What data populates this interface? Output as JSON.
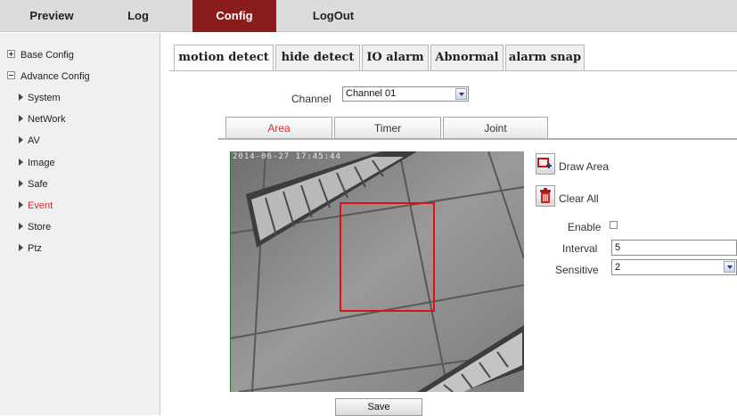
{
  "nav": {
    "items": [
      {
        "label": "Preview",
        "active": false
      },
      {
        "label": "Log",
        "active": false
      },
      {
        "label": "Config",
        "active": true
      },
      {
        "label": "LogOut",
        "active": false
      }
    ]
  },
  "sidebar": {
    "base_config": "Base Config",
    "advance_config": "Advance Config",
    "items": [
      {
        "label": "System"
      },
      {
        "label": "NetWork"
      },
      {
        "label": "AV"
      },
      {
        "label": "Image"
      },
      {
        "label": "Safe"
      },
      {
        "label": "Event",
        "active": true
      },
      {
        "label": "Store"
      },
      {
        "label": "Ptz"
      }
    ]
  },
  "main_tabs": [
    {
      "label": "motion detect",
      "active": true
    },
    {
      "label": "hide detect"
    },
    {
      "label": "IO alarm"
    },
    {
      "label": "Abnormal"
    },
    {
      "label": "alarm snap"
    }
  ],
  "channel": {
    "label": "Channel",
    "value": "Channel 01"
  },
  "sub_tabs": [
    {
      "label": "Area",
      "active": true
    },
    {
      "label": "Timer"
    },
    {
      "label": "Joint"
    }
  ],
  "video": {
    "timestamp": "2014-06-27 17:45:44"
  },
  "controls": {
    "draw_area": "Draw Area",
    "clear_all": "Clear All",
    "enable_label": "Enable",
    "enable_checked": false,
    "interval_label": "Interval",
    "interval_value": "5",
    "sensitive_label": "Sensitive",
    "sensitive_value": "2"
  },
  "save_label": "Save",
  "colors": {
    "active_nav": "#8b1c1c",
    "active_text": "#e3262c",
    "detect_box": "#e01010"
  },
  "icons": [
    "draw-area-icon",
    "trash-icon",
    "dropdown-arrow-icon"
  ]
}
